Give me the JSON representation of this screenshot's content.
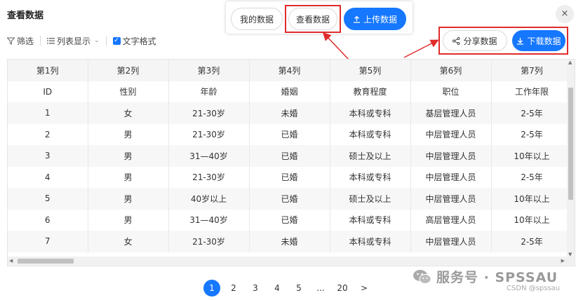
{
  "header": {
    "title": "查看数据",
    "close_icon": "×"
  },
  "toolbar": {
    "filter": "筛选",
    "list_display": "列表显示",
    "text_format": "文字格式"
  },
  "top_buttons": {
    "my_data": "我的数据",
    "view_data": "查看数据",
    "upload_data": "上传数据"
  },
  "right_buttons": {
    "share_data": "分享数据",
    "download_data": "下载数据"
  },
  "table": {
    "columns": [
      "第1列",
      "第2列",
      "第3列",
      "第4列",
      "第5列",
      "第6列",
      "第7列"
    ],
    "rows": [
      [
        "ID",
        "性别",
        "年龄",
        "婚姻",
        "教育程度",
        "职位",
        "工作年限"
      ],
      [
        "1",
        "女",
        "21-30岁",
        "未婚",
        "本科或专科",
        "基层管理人员",
        "2-5年"
      ],
      [
        "2",
        "男",
        "21-30岁",
        "已婚",
        "本科或专科",
        "中层管理人员",
        "2-5年"
      ],
      [
        "3",
        "男",
        "31—40岁",
        "已婚",
        "硕士及以上",
        "中层管理人员",
        "10年以上"
      ],
      [
        "4",
        "男",
        "21-30岁",
        "已婚",
        "本科或专科",
        "中层管理人员",
        "2-5年"
      ],
      [
        "5",
        "男",
        "40岁以上",
        "已婚",
        "硕士及以上",
        "中层管理人员",
        "10年以上"
      ],
      [
        "6",
        "男",
        "31—40岁",
        "已婚",
        "本科或专科",
        "高层管理人员",
        "10年以上"
      ],
      [
        "7",
        "女",
        "21-30岁",
        "未婚",
        "本科或专科",
        "中层管理人员",
        "2-5年"
      ]
    ]
  },
  "pagination": {
    "pages": [
      "1",
      "2",
      "3",
      "4",
      "5",
      "...",
      "20",
      ">"
    ],
    "current": "1"
  },
  "watermark": {
    "text": "服务号 · SPSSAU",
    "csdn": "CSDN @spssau"
  },
  "colors": {
    "primary": "#1677ff",
    "highlight_red": "#e02b2b"
  }
}
